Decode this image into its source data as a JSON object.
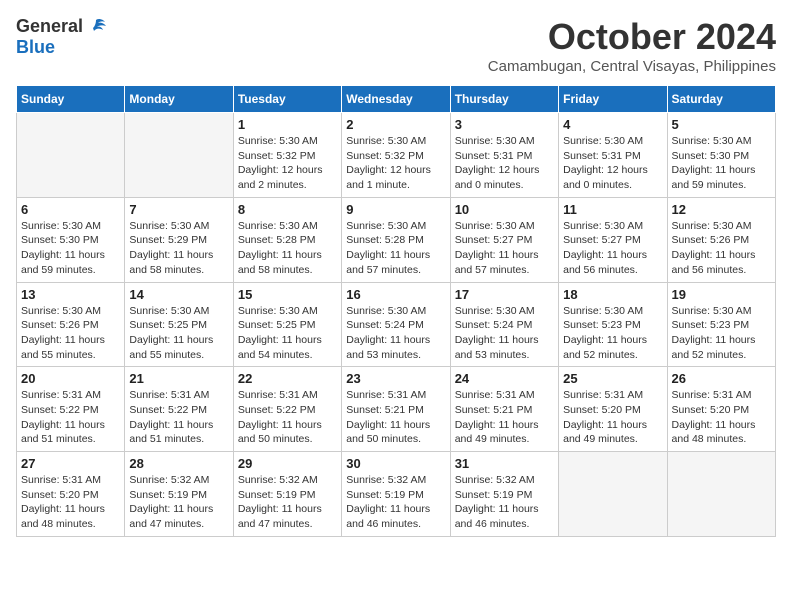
{
  "logo": {
    "general": "General",
    "blue": "Blue"
  },
  "title": "October 2024",
  "subtitle": "Camambugan, Central Visayas, Philippines",
  "days_header": [
    "Sunday",
    "Monday",
    "Tuesday",
    "Wednesday",
    "Thursday",
    "Friday",
    "Saturday"
  ],
  "weeks": [
    [
      {
        "day": "",
        "sunrise": "",
        "sunset": "",
        "daylight": "",
        "empty": true
      },
      {
        "day": "",
        "sunrise": "",
        "sunset": "",
        "daylight": "",
        "empty": true
      },
      {
        "day": "1",
        "sunrise": "Sunrise: 5:30 AM",
        "sunset": "Sunset: 5:32 PM",
        "daylight": "Daylight: 12 hours and 2 minutes.",
        "empty": false
      },
      {
        "day": "2",
        "sunrise": "Sunrise: 5:30 AM",
        "sunset": "Sunset: 5:32 PM",
        "daylight": "Daylight: 12 hours and 1 minute.",
        "empty": false
      },
      {
        "day": "3",
        "sunrise": "Sunrise: 5:30 AM",
        "sunset": "Sunset: 5:31 PM",
        "daylight": "Daylight: 12 hours and 0 minutes.",
        "empty": false
      },
      {
        "day": "4",
        "sunrise": "Sunrise: 5:30 AM",
        "sunset": "Sunset: 5:31 PM",
        "daylight": "Daylight: 12 hours and 0 minutes.",
        "empty": false
      },
      {
        "day": "5",
        "sunrise": "Sunrise: 5:30 AM",
        "sunset": "Sunset: 5:30 PM",
        "daylight": "Daylight: 11 hours and 59 minutes.",
        "empty": false
      }
    ],
    [
      {
        "day": "6",
        "sunrise": "Sunrise: 5:30 AM",
        "sunset": "Sunset: 5:30 PM",
        "daylight": "Daylight: 11 hours and 59 minutes.",
        "empty": false
      },
      {
        "day": "7",
        "sunrise": "Sunrise: 5:30 AM",
        "sunset": "Sunset: 5:29 PM",
        "daylight": "Daylight: 11 hours and 58 minutes.",
        "empty": false
      },
      {
        "day": "8",
        "sunrise": "Sunrise: 5:30 AM",
        "sunset": "Sunset: 5:28 PM",
        "daylight": "Daylight: 11 hours and 58 minutes.",
        "empty": false
      },
      {
        "day": "9",
        "sunrise": "Sunrise: 5:30 AM",
        "sunset": "Sunset: 5:28 PM",
        "daylight": "Daylight: 11 hours and 57 minutes.",
        "empty": false
      },
      {
        "day": "10",
        "sunrise": "Sunrise: 5:30 AM",
        "sunset": "Sunset: 5:27 PM",
        "daylight": "Daylight: 11 hours and 57 minutes.",
        "empty": false
      },
      {
        "day": "11",
        "sunrise": "Sunrise: 5:30 AM",
        "sunset": "Sunset: 5:27 PM",
        "daylight": "Daylight: 11 hours and 56 minutes.",
        "empty": false
      },
      {
        "day": "12",
        "sunrise": "Sunrise: 5:30 AM",
        "sunset": "Sunset: 5:26 PM",
        "daylight": "Daylight: 11 hours and 56 minutes.",
        "empty": false
      }
    ],
    [
      {
        "day": "13",
        "sunrise": "Sunrise: 5:30 AM",
        "sunset": "Sunset: 5:26 PM",
        "daylight": "Daylight: 11 hours and 55 minutes.",
        "empty": false
      },
      {
        "day": "14",
        "sunrise": "Sunrise: 5:30 AM",
        "sunset": "Sunset: 5:25 PM",
        "daylight": "Daylight: 11 hours and 55 minutes.",
        "empty": false
      },
      {
        "day": "15",
        "sunrise": "Sunrise: 5:30 AM",
        "sunset": "Sunset: 5:25 PM",
        "daylight": "Daylight: 11 hours and 54 minutes.",
        "empty": false
      },
      {
        "day": "16",
        "sunrise": "Sunrise: 5:30 AM",
        "sunset": "Sunset: 5:24 PM",
        "daylight": "Daylight: 11 hours and 53 minutes.",
        "empty": false
      },
      {
        "day": "17",
        "sunrise": "Sunrise: 5:30 AM",
        "sunset": "Sunset: 5:24 PM",
        "daylight": "Daylight: 11 hours and 53 minutes.",
        "empty": false
      },
      {
        "day": "18",
        "sunrise": "Sunrise: 5:30 AM",
        "sunset": "Sunset: 5:23 PM",
        "daylight": "Daylight: 11 hours and 52 minutes.",
        "empty": false
      },
      {
        "day": "19",
        "sunrise": "Sunrise: 5:30 AM",
        "sunset": "Sunset: 5:23 PM",
        "daylight": "Daylight: 11 hours and 52 minutes.",
        "empty": false
      }
    ],
    [
      {
        "day": "20",
        "sunrise": "Sunrise: 5:31 AM",
        "sunset": "Sunset: 5:22 PM",
        "daylight": "Daylight: 11 hours and 51 minutes.",
        "empty": false
      },
      {
        "day": "21",
        "sunrise": "Sunrise: 5:31 AM",
        "sunset": "Sunset: 5:22 PM",
        "daylight": "Daylight: 11 hours and 51 minutes.",
        "empty": false
      },
      {
        "day": "22",
        "sunrise": "Sunrise: 5:31 AM",
        "sunset": "Sunset: 5:22 PM",
        "daylight": "Daylight: 11 hours and 50 minutes.",
        "empty": false
      },
      {
        "day": "23",
        "sunrise": "Sunrise: 5:31 AM",
        "sunset": "Sunset: 5:21 PM",
        "daylight": "Daylight: 11 hours and 50 minutes.",
        "empty": false
      },
      {
        "day": "24",
        "sunrise": "Sunrise: 5:31 AM",
        "sunset": "Sunset: 5:21 PM",
        "daylight": "Daylight: 11 hours and 49 minutes.",
        "empty": false
      },
      {
        "day": "25",
        "sunrise": "Sunrise: 5:31 AM",
        "sunset": "Sunset: 5:20 PM",
        "daylight": "Daylight: 11 hours and 49 minutes.",
        "empty": false
      },
      {
        "day": "26",
        "sunrise": "Sunrise: 5:31 AM",
        "sunset": "Sunset: 5:20 PM",
        "daylight": "Daylight: 11 hours and 48 minutes.",
        "empty": false
      }
    ],
    [
      {
        "day": "27",
        "sunrise": "Sunrise: 5:31 AM",
        "sunset": "Sunset: 5:20 PM",
        "daylight": "Daylight: 11 hours and 48 minutes.",
        "empty": false
      },
      {
        "day": "28",
        "sunrise": "Sunrise: 5:32 AM",
        "sunset": "Sunset: 5:19 PM",
        "daylight": "Daylight: 11 hours and 47 minutes.",
        "empty": false
      },
      {
        "day": "29",
        "sunrise": "Sunrise: 5:32 AM",
        "sunset": "Sunset: 5:19 PM",
        "daylight": "Daylight: 11 hours and 47 minutes.",
        "empty": false
      },
      {
        "day": "30",
        "sunrise": "Sunrise: 5:32 AM",
        "sunset": "Sunset: 5:19 PM",
        "daylight": "Daylight: 11 hours and 46 minutes.",
        "empty": false
      },
      {
        "day": "31",
        "sunrise": "Sunrise: 5:32 AM",
        "sunset": "Sunset: 5:19 PM",
        "daylight": "Daylight: 11 hours and 46 minutes.",
        "empty": false
      },
      {
        "day": "",
        "sunrise": "",
        "sunset": "",
        "daylight": "",
        "empty": true
      },
      {
        "day": "",
        "sunrise": "",
        "sunset": "",
        "daylight": "",
        "empty": true
      }
    ]
  ]
}
